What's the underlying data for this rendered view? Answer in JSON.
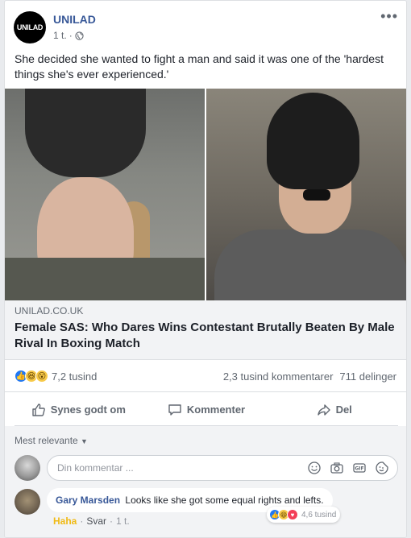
{
  "post": {
    "page_name": "UNILAD",
    "avatar_text": "UNILAD",
    "time": "1 t.",
    "text": "She decided she wanted to fight a man and said it was one of the 'hardest things she's ever experienced.'"
  },
  "link": {
    "domain": "UNILAD.CO.UK",
    "headline": "Female SAS: Who Dares Wins Contestant Brutally Beaten By Male Rival In Boxing Match"
  },
  "stats": {
    "reaction_icons": [
      "like-icon",
      "haha-icon",
      "wow-icon"
    ],
    "reaction_count": "7,2 tusind",
    "comments": "2,3 tusind kommentarer",
    "shares": "711 delinger"
  },
  "actions": {
    "like": "Synes godt om",
    "comment": "Kommenter",
    "share": "Del"
  },
  "comments_section": {
    "sort_label": "Mest relevante",
    "input_placeholder": "Din kommentar ...",
    "comments": [
      {
        "author": "Gary Marsden",
        "text": "Looks like she got some equal rights and lefts.",
        "reaction_count": "4,6 tusind",
        "reaction_icons": [
          "like-icon",
          "haha-icon",
          "love-icon"
        ],
        "my_reaction": "Haha",
        "reply_label": "Svar",
        "time": "1 t."
      }
    ]
  },
  "colors": {
    "brand_link": "#385898",
    "like_blue": "#2078f4",
    "haha_yellow": "#f0ba15"
  }
}
